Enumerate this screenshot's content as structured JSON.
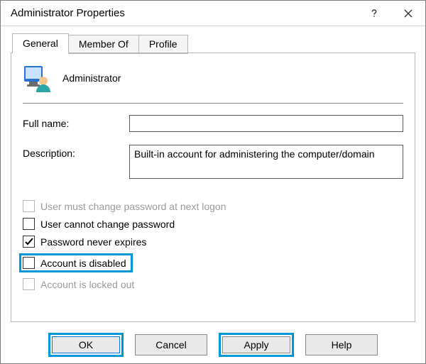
{
  "window": {
    "title": "Administrator Properties"
  },
  "tabs": {
    "general": "General",
    "memberof": "Member Of",
    "profile": "Profile"
  },
  "header": {
    "name": "Administrator"
  },
  "form": {
    "fullname_label": "Full name:",
    "fullname_value": "",
    "description_label": "Description:",
    "description_value": "Built-in account for administering the computer/domain"
  },
  "checks": {
    "change_next_logon": "User must change password at next logon",
    "cannot_change": "User cannot change password",
    "never_expires": "Password never expires",
    "disabled": "Account is disabled",
    "locked_out": "Account is locked out"
  },
  "buttons": {
    "ok": "OK",
    "cancel": "Cancel",
    "apply": "Apply",
    "help": "Help"
  }
}
